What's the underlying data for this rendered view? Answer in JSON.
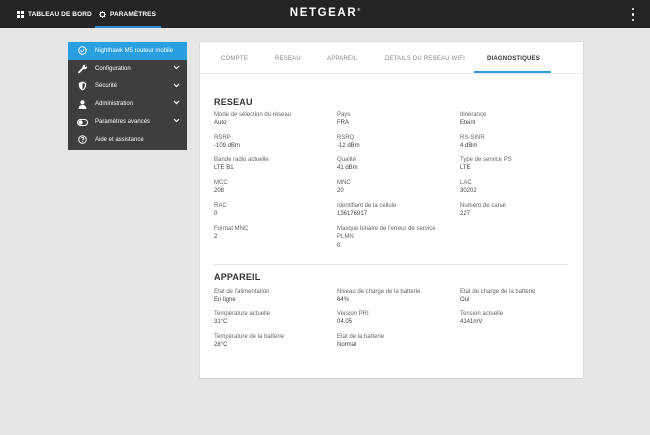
{
  "topbar": {
    "dashboard_label": "TABLEAU DE BORD",
    "settings_label": "PARAMÈTRES",
    "brand": "NETGEAR",
    "brand_mark": "®"
  },
  "sidebar": {
    "items": [
      {
        "label": "Nighthawk M5 routeur mobile",
        "icon": "check-circle-icon",
        "active": true
      },
      {
        "label": "Configuration",
        "icon": "wrench-icon"
      },
      {
        "label": "Sécurité",
        "icon": "shield-icon"
      },
      {
        "label": "Administration",
        "icon": "user-icon"
      },
      {
        "label": "Paramètres avancés",
        "icon": "toggle-icon"
      },
      {
        "label": "Aide et assistance",
        "icon": "help-icon"
      }
    ]
  },
  "tabs": [
    "COMPTE",
    "RESEAU",
    "APPAREIL",
    "DETAILS DU RESEAU WIFI",
    "DIAGNOSTIQUES"
  ],
  "active_tab": "DIAGNOSTIQUES",
  "reseau": {
    "title": "RESEAU",
    "fields": [
      {
        "label": "Mode de sélection du réseau",
        "value": "Auto"
      },
      {
        "label": "Pays",
        "value": "FRA"
      },
      {
        "label": "Itinérance",
        "value": "Eteint"
      },
      {
        "label": "RSRP",
        "value": "-109 dBm"
      },
      {
        "label": "RSRQ",
        "value": "-12 dBm"
      },
      {
        "label": "RS-SINR",
        "value": "4 dBm"
      },
      {
        "label": "Bande radio actuelle",
        "value": "LTE B1"
      },
      {
        "label": "Qualité",
        "value": "41 dBm"
      },
      {
        "label": "Type de service PS",
        "value": "LTE"
      },
      {
        "label": "MCC",
        "value": "208"
      },
      {
        "label": "MNC",
        "value": "20"
      },
      {
        "label": "LAC",
        "value": "30202"
      },
      {
        "label": "RAC",
        "value": "0"
      },
      {
        "label": "Identifiant de la cellule",
        "value": "136176917"
      },
      {
        "label": "Numéro de canal",
        "value": "227"
      },
      {
        "label": "Format MNC",
        "value": "2"
      },
      {
        "label": "Masque binaire de l'erreur de service PLMN",
        "value": "0"
      }
    ]
  },
  "appareil": {
    "title": "APPAREIL",
    "fields": [
      {
        "label": "Etat de l'alimentation",
        "value": "En ligne"
      },
      {
        "label": "Niveau de charge de la batterie",
        "value": "64%"
      },
      {
        "label": "Etat de charge de la batterie",
        "value": "Oui"
      },
      {
        "label": "Température actuelle",
        "value": "31°C"
      },
      {
        "label": "Version PRI",
        "value": "04.05"
      },
      {
        "label": "Tension actuelle",
        "value": "4141mV"
      },
      {
        "label": "Température de la batterie",
        "value": "28°C"
      },
      {
        "label": "Etat de la batterie",
        "value": "Normal"
      }
    ]
  }
}
